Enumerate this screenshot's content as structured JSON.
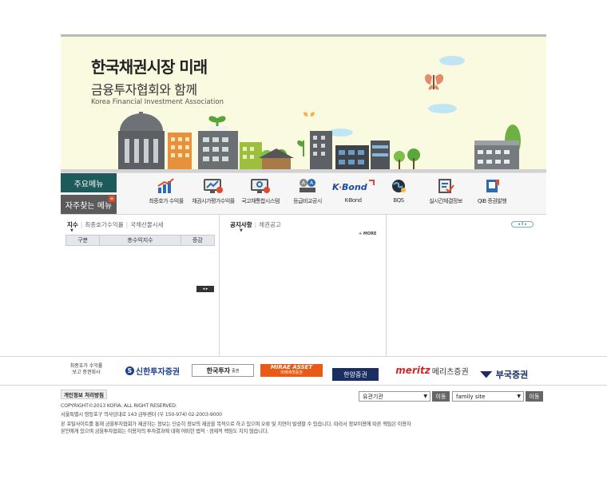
{
  "banner": {
    "title": "한국채권시장 미래",
    "subtitle": "금융투자협회와 함께",
    "english": "Korea Financial Investment Association"
  },
  "nav": {
    "main_menu": "주요메뉴",
    "fav_menu": "자주찾는 메뉴",
    "fav_plus": "+",
    "items": [
      {
        "label": "최종호가 수익률",
        "icon": "bar-chart-icon"
      },
      {
        "label": "채권시가평가수익률",
        "icon": "monitor-chart-icon"
      },
      {
        "label": "국고채통합시스템",
        "icon": "monitor-gear-icon"
      },
      {
        "label": "등급비교공시",
        "icon": "grade-compare-icon"
      },
      {
        "label": "K-Bond",
        "icon": "kbond-logo"
      },
      {
        "label": "BQS",
        "icon": "globe-icon"
      },
      {
        "label": "실시간체결정보",
        "icon": "document-check-icon"
      },
      {
        "label": "QIB 증권발행",
        "icon": "book-icon"
      }
    ]
  },
  "left_panel": {
    "tabs": [
      "지수",
      "최종호가수익률",
      "국채선물시세"
    ],
    "table_headers": [
      "구분",
      "총수익지수",
      "증감"
    ],
    "pager": "◂ ▸"
  },
  "middle_panel": {
    "tabs": [
      "공지사항",
      "채권공고"
    ],
    "more": "+ MORE"
  },
  "right_panel": {
    "pager": "◂ II ▸"
  },
  "partners": {
    "label": "최종호가 수익률\n보고 증권회사",
    "logos": {
      "shinhan": "신한투자증권",
      "shinhan_mark": "S",
      "hankook": "한국투자",
      "hankook_small": "증권",
      "mirae_en": "MIRAE ASSET",
      "mirae_ko": "미래에셋증권",
      "hanyang": "한양증권",
      "meritz_en": "meritz",
      "meritz_ko": "메리츠증권",
      "bukook": "부국증권"
    }
  },
  "footer": {
    "privacy": "개인정보 처리방침",
    "select_related": "유관기관",
    "select_family": "family site",
    "go_label": "이동",
    "copyright": "COPYRIGHT©2013 KOFIA. ALL RIGHT RESERVED.",
    "address": "서울특별시 영등포구 의사당대로 143 금투센터 (우 150-974) 02-2003-9000",
    "disclaimer1": "본 포탈사이트를 통해 금융투자협회가 제공하는 정보는 단순히 정보의 제공을 목적으로 하고 있으며 오류 및 지연이 발생할 수 있습니다. 따라서 정보이용에 따른 책임은 이용자",
    "disclaimer2": "본인에게 있으며 금융투자협회는 이용자의 투자결과에 대해 어떠한 법적 · 경제적 책임도 지지 않습니다."
  }
}
